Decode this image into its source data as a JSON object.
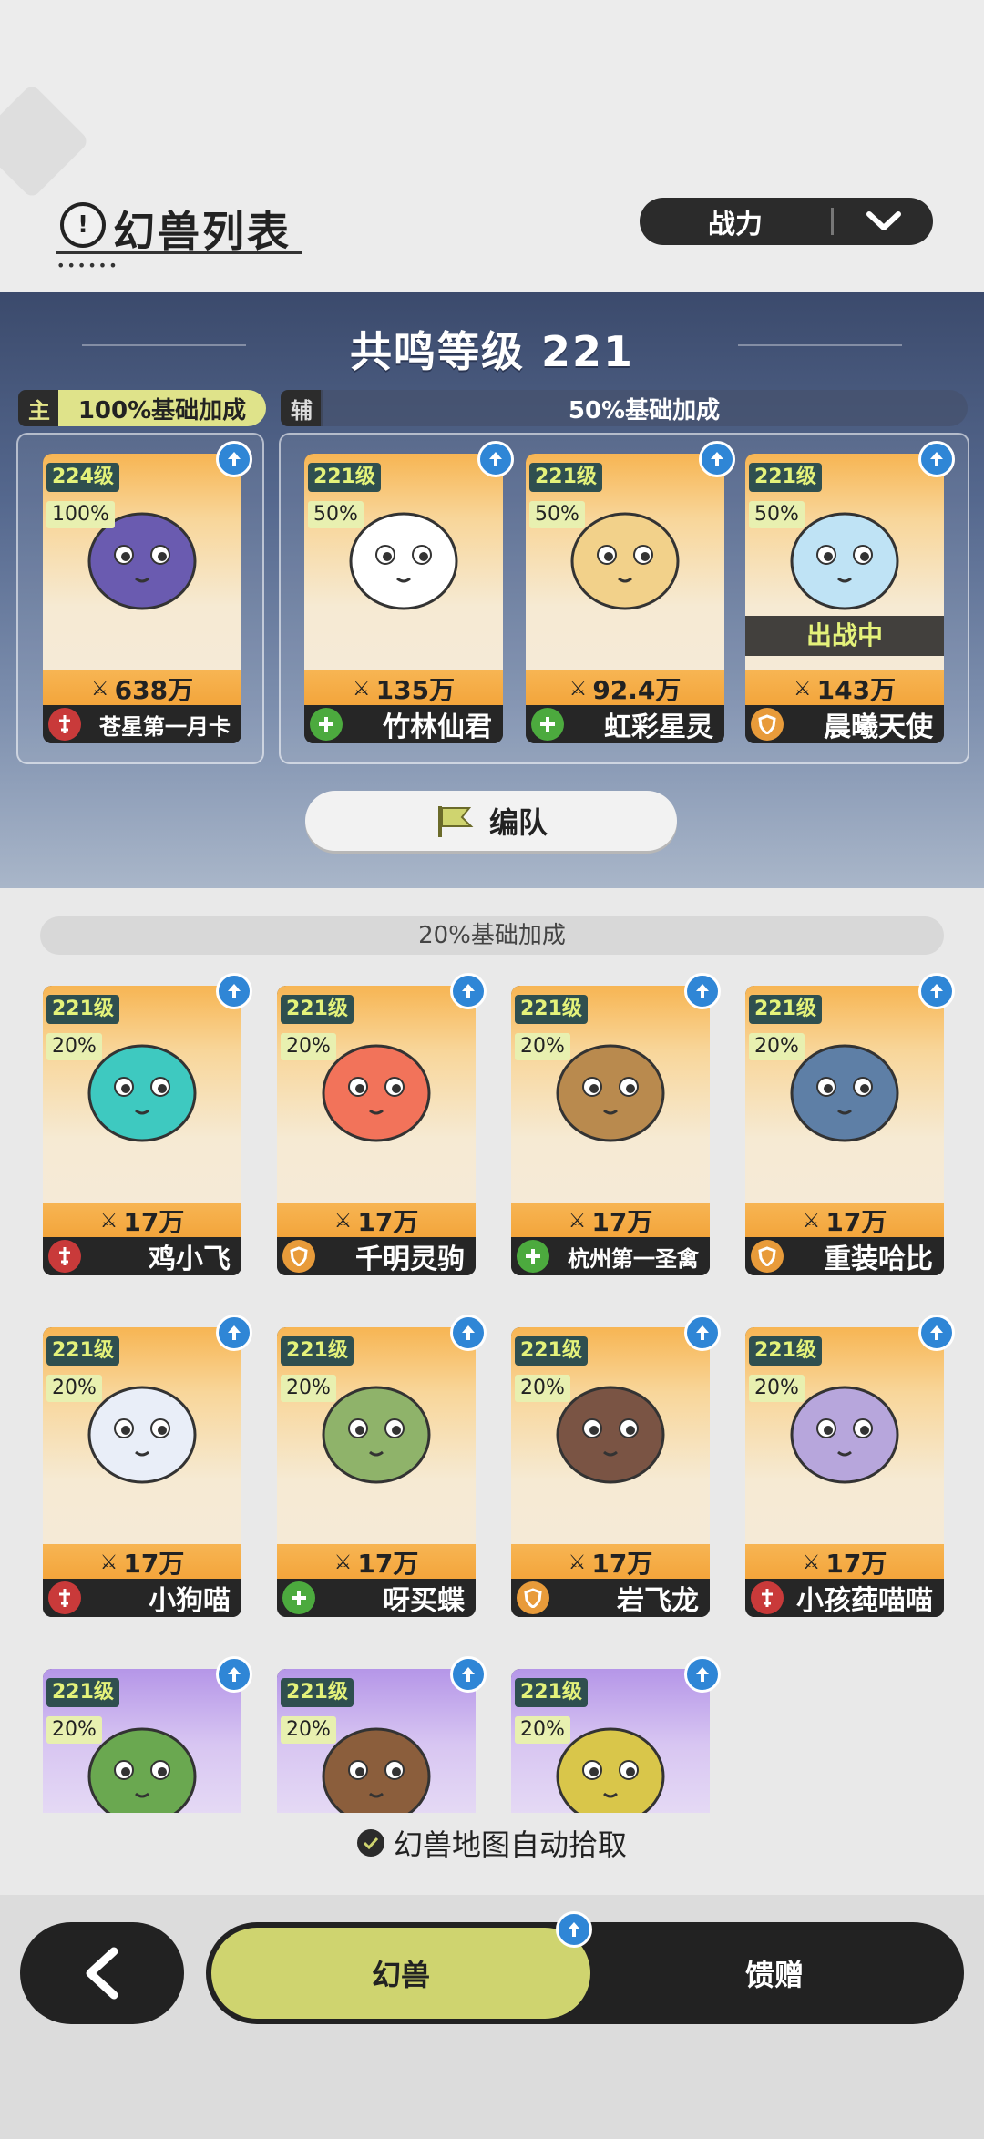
{
  "header": {
    "title": "幻兽列表",
    "sort": {
      "label": "战力"
    }
  },
  "resonance": {
    "title": "共鸣等级 221",
    "main_role": "主",
    "main_bonus": "100%基础加成",
    "support_role": "辅",
    "support_bonus": "50%基础加成",
    "formation_button": "编队"
  },
  "team": [
    {
      "level": "224级",
      "percent": "100%",
      "power": "638万",
      "name": "苍星第一月卡",
      "role": "atk",
      "color": "#6a5bb0"
    },
    {
      "level": "221级",
      "percent": "50%",
      "power": "135万",
      "name": "竹林仙君",
      "role": "heal",
      "color": "#ffffff"
    },
    {
      "level": "221级",
      "percent": "50%",
      "power": "92.4万",
      "name": "虹彩星灵",
      "role": "heal",
      "color": "#f2d18a"
    },
    {
      "level": "221级",
      "percent": "50%",
      "power": "143万",
      "name": "晨曦天使",
      "role": "def",
      "color": "#bfe3f5",
      "status": "出战中"
    }
  ],
  "list": {
    "header": "20%基础加成",
    "items": [
      {
        "level": "221级",
        "percent": "20%",
        "power": "17万",
        "name": "鸡小飞",
        "role": "atk",
        "color": "#3ec9c0",
        "theme": "orange"
      },
      {
        "level": "221级",
        "percent": "20%",
        "power": "17万",
        "name": "千明灵驹",
        "role": "def",
        "color": "#f2735a",
        "theme": "orange"
      },
      {
        "level": "221级",
        "percent": "20%",
        "power": "17万",
        "name": "杭州第一圣禽",
        "role": "heal",
        "color": "#b98a4e",
        "theme": "orange"
      },
      {
        "level": "221级",
        "percent": "20%",
        "power": "17万",
        "name": "重装哈比",
        "role": "def",
        "color": "#5e7fa6",
        "theme": "orange"
      },
      {
        "level": "221级",
        "percent": "20%",
        "power": "17万",
        "name": "小狗喵",
        "role": "atk",
        "color": "#e9eef8",
        "theme": "orange"
      },
      {
        "level": "221级",
        "percent": "20%",
        "power": "17万",
        "name": "呀买蝶",
        "role": "heal",
        "color": "#8fb36a",
        "theme": "orange"
      },
      {
        "level": "221级",
        "percent": "20%",
        "power": "17万",
        "name": "岩飞龙",
        "role": "def",
        "color": "#7a5444",
        "theme": "orange"
      },
      {
        "level": "221级",
        "percent": "20%",
        "power": "17万",
        "name": "小孩莼喵喵",
        "role": "atk",
        "color": "#b7a6dc",
        "theme": "orange"
      },
      {
        "level": "221级",
        "percent": "20%",
        "power": "",
        "name": "",
        "role": "",
        "color": "#6aa850",
        "theme": "purple"
      },
      {
        "level": "221级",
        "percent": "20%",
        "power": "",
        "name": "",
        "role": "",
        "color": "#8b5e3c",
        "theme": "purple"
      },
      {
        "level": "221级",
        "percent": "20%",
        "power": "",
        "name": "",
        "role": "",
        "color": "#d9c64a",
        "theme": "purple"
      }
    ]
  },
  "auto_pickup": "幻兽地图自动拾取",
  "bottom_nav": {
    "tab_beasts": "幻兽",
    "tab_gift": "馈赠"
  },
  "role_icons": {
    "atk": "sword-icon",
    "heal": "plus-icon",
    "def": "shield-icon"
  }
}
